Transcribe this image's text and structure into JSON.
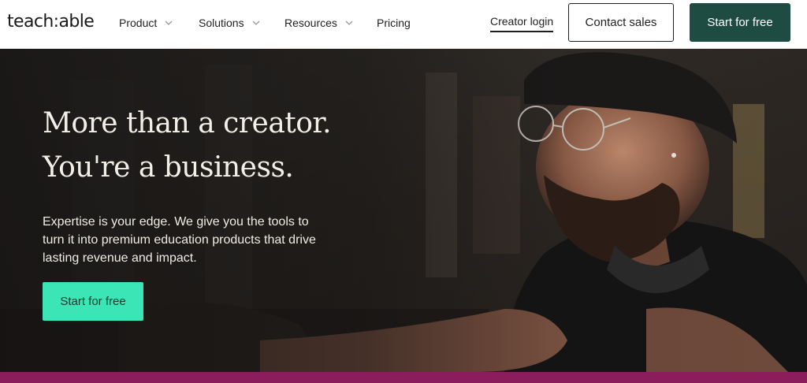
{
  "brand": {
    "logo_text": "teach:able"
  },
  "nav": {
    "items": [
      {
        "label": "Product",
        "has_dropdown": true
      },
      {
        "label": "Solutions",
        "has_dropdown": true
      },
      {
        "label": "Resources",
        "has_dropdown": true
      },
      {
        "label": "Pricing",
        "has_dropdown": false
      }
    ],
    "creator_login": "Creator login",
    "contact_sales": "Contact sales",
    "start_free": "Start for free"
  },
  "hero": {
    "title_line1": "More than a creator.",
    "title_line2": "You're a business.",
    "description_lines": [
      "Expertise is your edge. We give you the tools to",
      "turn it into premium education products that drive",
      "lasting revenue and impact."
    ],
    "cta_label": "Start for free"
  },
  "colors": {
    "nav_cta_bg": "#1e4b42",
    "hero_cta_bg": "#3ce5b5",
    "bottom_band": "#8b1d5c"
  },
  "icons": {
    "dropdown": "chevron-down-icon"
  }
}
